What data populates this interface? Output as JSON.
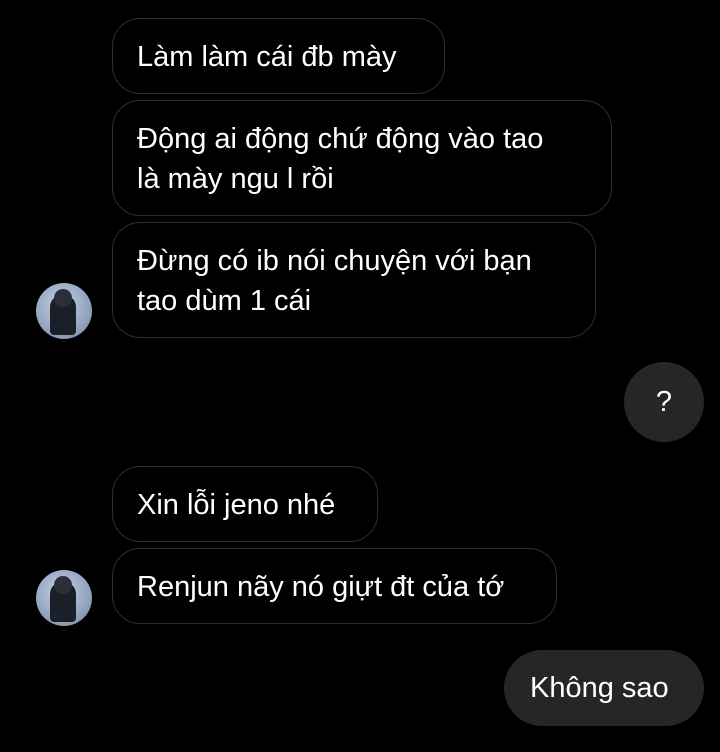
{
  "messages": [
    {
      "id": "m1",
      "side": "incoming",
      "lines": [
        "Làm làm cái đb mày"
      ]
    },
    {
      "id": "m2",
      "side": "incoming",
      "lines": [
        "Động ai động chứ động vào tao",
        "là mày ngu l rồi"
      ]
    },
    {
      "id": "m3",
      "side": "incoming",
      "lines": [
        "Đừng có ib nói chuyện với bạn",
        "tao dùm 1 cái"
      ]
    },
    {
      "id": "m4",
      "side": "outgoing",
      "lines": [
        "?"
      ]
    },
    {
      "id": "m5",
      "side": "incoming",
      "lines": [
        "Xin lỗi jeno nhé"
      ]
    },
    {
      "id": "m6",
      "side": "incoming",
      "lines": [
        "Renjun nãy nó giựt đt của tớ"
      ]
    },
    {
      "id": "m7",
      "side": "outgoing",
      "lines": [
        "Không sao"
      ]
    }
  ],
  "colors": {
    "background": "#000000",
    "incoming_border": "#2f2f2f",
    "outgoing_bubble": "#262626",
    "text": "#ffffff"
  }
}
